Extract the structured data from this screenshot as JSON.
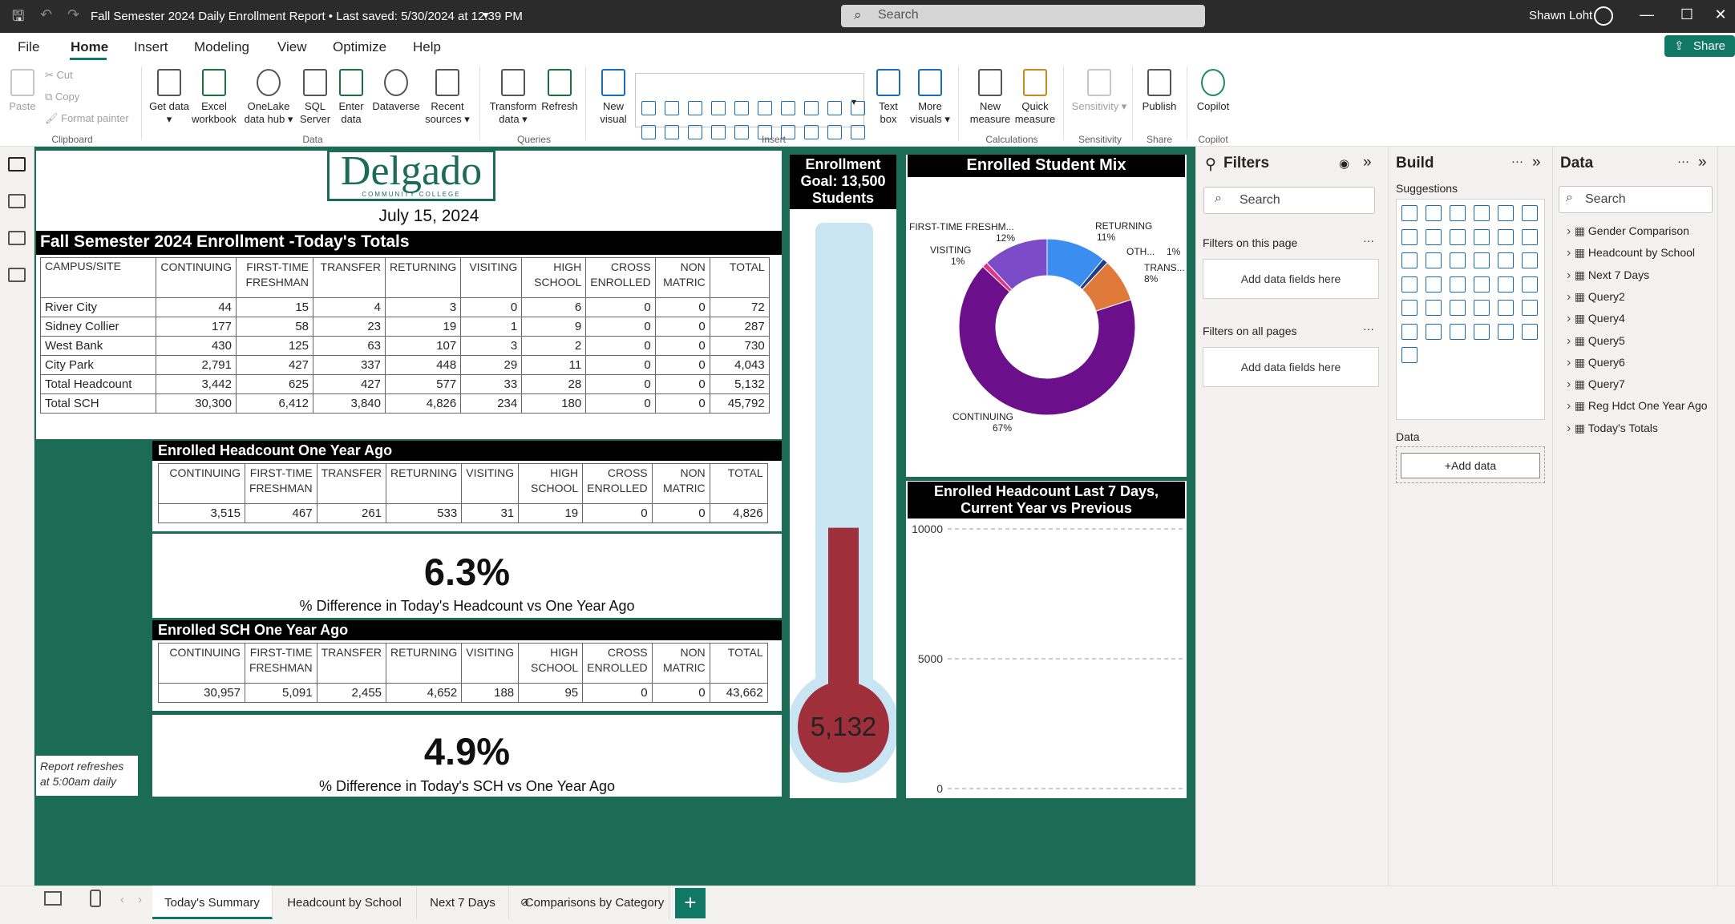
{
  "titlebar": {
    "doc_title": "Fall Semester 2024 Daily Enrollment Report • Last saved: 5/30/2024 at 12:39 PM",
    "search_placeholder": "Search",
    "user_name": "Shawn Loht"
  },
  "menu": {
    "items": [
      "File",
      "Home",
      "Insert",
      "Modeling",
      "View",
      "Optimize",
      "Help"
    ],
    "share_label": "Share"
  },
  "ribbon": {
    "clipboard": {
      "paste": "Paste",
      "cut": "Cut",
      "copy": "Copy",
      "format_painter": "Format painter",
      "group": "Clipboard"
    },
    "data": {
      "get_data": "Get data ▾",
      "excel": "Excel workbook",
      "onelake": "OneLake data hub ▾",
      "sql": "SQL Server",
      "enter": "Enter data",
      "dataverse": "Dataverse",
      "recent": "Recent sources ▾",
      "group": "Data"
    },
    "queries": {
      "transform": "Transform data ▾",
      "refresh": "Refresh",
      "group": "Queries"
    },
    "insert": {
      "new_visual": "New visual",
      "text_box": "Text box",
      "more_visuals": "More visuals ▾",
      "group": "Insert"
    },
    "calculations": {
      "new_measure": "New measure",
      "quick_measure": "Quick measure",
      "group": "Calculations"
    },
    "sensitivity": {
      "label": "Sensitivity ▾",
      "group": "Sensitivity"
    },
    "share": {
      "publish": "Publish",
      "group": "Share"
    },
    "copilot": {
      "label": "Copilot",
      "group": "Copilot"
    }
  },
  "report": {
    "logo_text": "Delgado",
    "logo_sub": "COMMUNITY COLLEGE",
    "date": "July 15, 2024",
    "todays_title": "Fall Semester 2024 Enrollment -Today's Totals",
    "columns": [
      "CAMPUS/SITE",
      "CONTINUING",
      "FIRST-TIME FRESHMAN",
      "TRANSFER",
      "RETURNING",
      "VISITING",
      "HIGH SCHOOL",
      "CROSS ENROLLED",
      "NON MATRIC",
      "TOTAL"
    ],
    "rows": [
      [
        "River City",
        "44",
        "15",
        "4",
        "3",
        "0",
        "6",
        "0",
        "0",
        "72"
      ],
      [
        "Sidney Collier",
        "177",
        "58",
        "23",
        "19",
        "1",
        "9",
        "0",
        "0",
        "287"
      ],
      [
        "West Bank",
        "430",
        "125",
        "63",
        "107",
        "3",
        "2",
        "0",
        "0",
        "730"
      ],
      [
        "City Park",
        "2,791",
        "427",
        "337",
        "448",
        "29",
        "11",
        "0",
        "0",
        "4,043"
      ],
      [
        "Total Headcount",
        "3,442",
        "625",
        "427",
        "577",
        "33",
        "28",
        "0",
        "0",
        "5,132"
      ],
      [
        "Total SCH",
        "30,300",
        "6,412",
        "3,840",
        "4,826",
        "234",
        "180",
        "0",
        "0",
        "45,792"
      ]
    ],
    "hc_year_ago": {
      "title": "Enrolled Headcount One Year Ago",
      "columns": [
        "CONTINUING",
        "FIRST-TIME FRESHMAN",
        "TRANSFER",
        "RETURNING",
        "VISITING",
        "HIGH SCHOOL",
        "CROSS ENROLLED",
        "NON MATRIC",
        "TOTAL"
      ],
      "values": [
        "3,515",
        "467",
        "261",
        "533",
        "31",
        "19",
        "0",
        "0",
        "4,826"
      ]
    },
    "hc_diff": {
      "value": "6.3%",
      "label": "% Difference in Today's Headcount vs One Year Ago"
    },
    "sch_year_ago": {
      "title": "Enrolled SCH One Year Ago",
      "columns": [
        "CONTINUING",
        "FIRST-TIME FRESHMAN",
        "TRANSFER",
        "RETURNING",
        "VISITING",
        "HIGH SCHOOL",
        "CROSS ENROLLED",
        "NON MATRIC",
        "TOTAL"
      ],
      "values": [
        "30,957",
        "5,091",
        "2,455",
        "4,652",
        "188",
        "95",
        "0",
        "0",
        "43,662"
      ]
    },
    "sch_diff": {
      "value": "4.9%",
      "label": "% Difference in Today's SCH vs One Year Ago"
    },
    "refresh_note": "Report refreshes at 5:00am daily",
    "goal": {
      "title": "Enrollment Goal: 13,500 Students",
      "current": "5,132",
      "current_value": 5132,
      "goal_value": 13500
    },
    "mix_title": "Enrolled Student Mix",
    "last7_title": "Enrolled Headcount Last 7 Days, Current Year vs Previous"
  },
  "chart_data": [
    {
      "type": "pie",
      "title": "Enrolled Student Mix",
      "slices": [
        {
          "label": "CONTINUING",
          "pct": "67%",
          "value": 67,
          "color": "#6b0f8a"
        },
        {
          "label": "FIRST-TIME FRESHM...",
          "pct": "12%",
          "value": 12,
          "color": "#7b4bc8"
        },
        {
          "label": "RETURNING",
          "pct": "11%",
          "value": 11,
          "color": "#3b8ef0"
        },
        {
          "label": "TRANS...",
          "pct": "8%",
          "value": 8,
          "color": "#e07a3a"
        },
        {
          "label": "OTH...",
          "pct": "1%",
          "value": 1,
          "color": "#1f3e8a"
        },
        {
          "label": "VISITING",
          "pct": "1%",
          "value": 1,
          "color": "#e0338a"
        }
      ]
    },
    {
      "type": "line",
      "title": "Enrolled Headcount Last 7 Days, Current Year vs Previous",
      "yticks": [
        "10000",
        "5000",
        "0"
      ],
      "ylim": [
        0,
        10000
      ],
      "series": []
    }
  ],
  "filters": {
    "title": "Filters",
    "search": "Search",
    "on_page": "Filters on this page",
    "all_pages": "Filters on all pages",
    "add_fields": "Add data fields here"
  },
  "build": {
    "title": "Build",
    "suggestions": "Suggestions",
    "data_label": "Data",
    "add_data": "+Add data"
  },
  "data": {
    "title": "Data",
    "search": "Search",
    "tables": [
      "Gender Comparison",
      "Headcount by School",
      "Next 7 Days",
      "Query2",
      "Query4",
      "Query5",
      "Query6",
      "Query7",
      "Reg Hdct One Year Ago",
      "Today's Totals"
    ]
  },
  "tabs": [
    "Today's Summary",
    "Headcount by School",
    "Next 7 Days",
    "Comparisons by Category"
  ]
}
